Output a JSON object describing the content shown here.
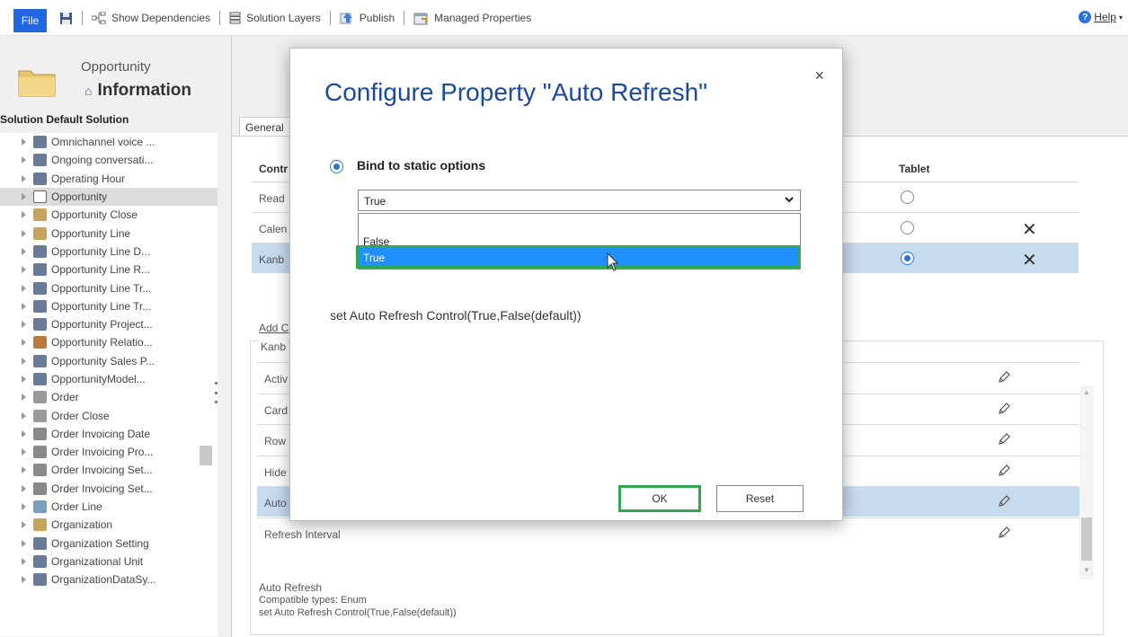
{
  "toolbar": {
    "file": "File",
    "show_dependencies": "Show Dependencies",
    "solution_layers": "Solution Layers",
    "publish": "Publish",
    "managed_properties": "Managed Properties",
    "help": "Help"
  },
  "entity": {
    "name": "Opportunity",
    "section": "Information",
    "solution_label": "Solution Default Solution"
  },
  "tree": {
    "items": [
      {
        "label": "Omnichannel voice ...",
        "icon_color": "#6a7b99"
      },
      {
        "label": "Ongoing conversati...",
        "icon_color": "#6a7b99"
      },
      {
        "label": "Operating Hour",
        "icon_color": "#6a7b99"
      },
      {
        "label": "Opportunity",
        "icon_color": "#ffffff",
        "selected": true
      },
      {
        "label": "Opportunity Close",
        "icon_color": "#c9a35a"
      },
      {
        "label": "Opportunity Line",
        "icon_color": "#c9a35a"
      },
      {
        "label": "Opportunity Line D...",
        "icon_color": "#6a7b99"
      },
      {
        "label": "Opportunity Line R...",
        "icon_color": "#6a7b99"
      },
      {
        "label": "Opportunity Line Tr...",
        "icon_color": "#6a7b99"
      },
      {
        "label": "Opportunity Line Tr...",
        "icon_color": "#6a7b99"
      },
      {
        "label": "Opportunity Project...",
        "icon_color": "#6a7b99"
      },
      {
        "label": "Opportunity Relatio...",
        "icon_color": "#b87a3d"
      },
      {
        "label": "Opportunity Sales P...",
        "icon_color": "#6a7b99"
      },
      {
        "label": "OpportunityModel...",
        "icon_color": "#6a7b99"
      },
      {
        "label": "Order",
        "icon_color": "#9a9a9a"
      },
      {
        "label": "Order Close",
        "icon_color": "#9a9a9a"
      },
      {
        "label": "Order Invoicing Date",
        "icon_color": "#8a8a8a"
      },
      {
        "label": "Order Invoicing Pro...",
        "icon_color": "#8a8a8a"
      },
      {
        "label": "Order Invoicing Set...",
        "icon_color": "#8a8a8a"
      },
      {
        "label": "Order Invoicing Set...",
        "icon_color": "#8a8a8a"
      },
      {
        "label": "Order Line",
        "icon_color": "#7aa0c0"
      },
      {
        "label": "Organization",
        "icon_color": "#c9a35a"
      },
      {
        "label": "Organization Setting",
        "icon_color": "#6a7b99"
      },
      {
        "label": "Organizational Unit",
        "icon_color": "#6a7b99"
      },
      {
        "label": "OrganizationDataSy...",
        "icon_color": "#6a7b99"
      }
    ]
  },
  "main": {
    "tab_general": "General",
    "control_header": "Contr",
    "tablet_header": "Tablet",
    "control_rows": [
      {
        "label": "Read",
        "radio_on": false,
        "removable": false,
        "highlight": false
      },
      {
        "label": "Calen",
        "radio_on": false,
        "removable": true,
        "highlight": false
      },
      {
        "label": "Kanb",
        "radio_on": true,
        "removable": true,
        "highlight": true
      }
    ],
    "add_control": "Add C",
    "kanban_title": "Kanb",
    "properties": [
      {
        "label": "Activ",
        "highlight": false
      },
      {
        "label": "Card",
        "highlight": false
      },
      {
        "label": "Row",
        "highlight": false
      },
      {
        "label": "Hide",
        "highlight": false
      },
      {
        "label": "Auto",
        "highlight": true
      },
      {
        "label": "Refresh Interval",
        "highlight": false
      }
    ],
    "description": {
      "name": "Auto Refresh",
      "types": "Compatible types: Enum",
      "text": "set Auto Refresh Control(True,False(default))"
    }
  },
  "dialog": {
    "title": "Configure Property \"Auto Refresh\"",
    "close": "×",
    "option_label": "Bind to static options",
    "selected_value": "True",
    "options": [
      "False",
      "True"
    ],
    "description": "set Auto Refresh Control(True,False(default))",
    "ok": "OK",
    "reset": "Reset"
  },
  "colors": {
    "accent": "#2b74d8",
    "highlight_row": "#c7dbef",
    "selected_option": "#1e90ff",
    "annotation_green": "#2fa84f",
    "title_blue": "#1a4a9f"
  }
}
